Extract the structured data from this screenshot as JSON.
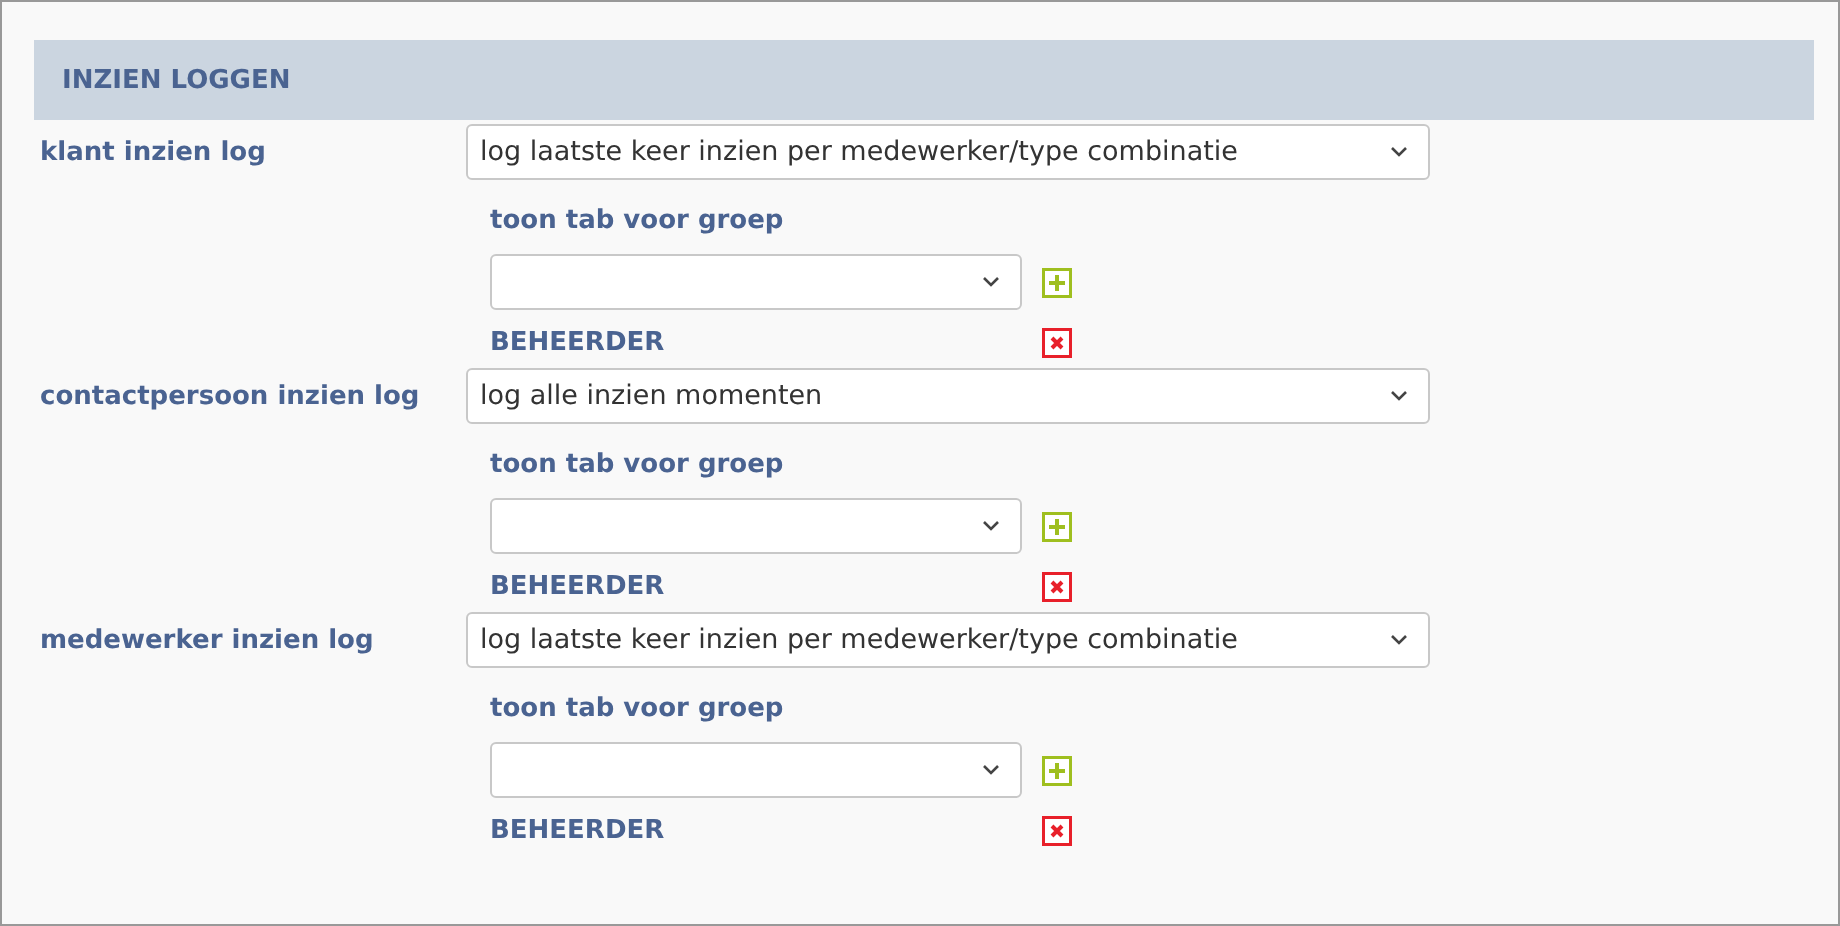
{
  "section": {
    "title": "INZIEN LOGGEN"
  },
  "rows": [
    {
      "label": "klant inzien log",
      "value": "log laatste keer inzien per medewerker/type combinatie",
      "group_label": "toon tab voor groep",
      "groups": [
        "BEHEERDER"
      ]
    },
    {
      "label": "contactpersoon inzien log",
      "value": "log alle inzien momenten",
      "group_label": "toon tab voor groep",
      "groups": [
        "BEHEERDER"
      ]
    },
    {
      "label": "medewerker inzien log",
      "value": "log laatste keer inzien per medewerker/type combinatie",
      "group_label": "toon tab voor groep",
      "groups": [
        "BEHEERDER"
      ]
    }
  ]
}
